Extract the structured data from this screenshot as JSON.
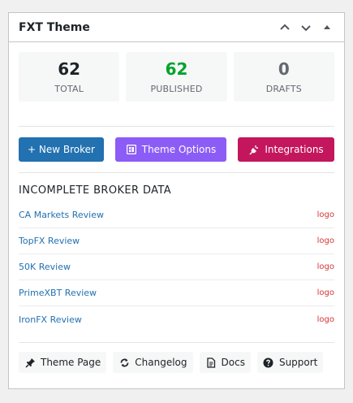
{
  "widget": {
    "title": "FXT Theme",
    "controls": [
      "chevron-up-icon",
      "chevron-down-icon",
      "triangle-up-icon"
    ]
  },
  "stats": [
    {
      "value": "62",
      "label": "TOTAL",
      "color": "#1d2327"
    },
    {
      "value": "62",
      "label": "PUBLISHED",
      "color": "#00a32a"
    },
    {
      "value": "0",
      "label": "DRAFTS",
      "color": "#646970"
    }
  ],
  "actions": {
    "new_broker": "+ New Broker",
    "theme_options": "Theme Options",
    "integrations": "Integrations"
  },
  "incomplete": {
    "title": "INCOMPLETE BROKER DATA",
    "rows": [
      {
        "name": "CA Markets Review",
        "missing": "logo"
      },
      {
        "name": "TopFX Review",
        "missing": "logo"
      },
      {
        "name": "50K Review",
        "missing": "logo"
      },
      {
        "name": "PrimeXBT Review",
        "missing": "logo"
      },
      {
        "name": "IronFX Review",
        "missing": "logo"
      }
    ]
  },
  "footer": {
    "theme_page": "Theme Page",
    "changelog": "Changelog",
    "docs": "Docs",
    "support": "Support"
  },
  "colors": {
    "primary": "#2271b1",
    "purple": "#8c5cf6",
    "magenta": "#c4165d",
    "published": "#00a32a",
    "warning": "#d63638"
  }
}
